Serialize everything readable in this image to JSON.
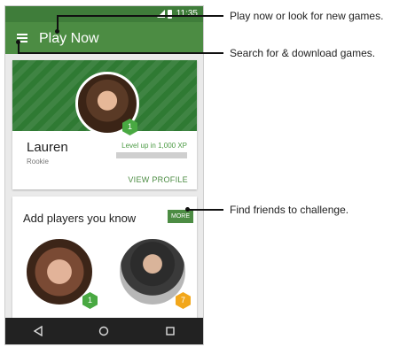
{
  "status_bar": {
    "time": "11:35"
  },
  "app_bar": {
    "title": "Play Now"
  },
  "profile": {
    "name": "Lauren",
    "rank": "Rookie",
    "level": "1",
    "level_up_text": "Level up in 1,000 XP",
    "xp_progress": 0,
    "view_profile_label": "VIEW PROFILE"
  },
  "players": {
    "title": "Add players you know",
    "more_label": "MORE",
    "items": [
      {
        "level": "1"
      },
      {
        "level": "7"
      }
    ]
  },
  "nav": {
    "back": "back-icon",
    "home": "home-icon",
    "recents": "recents-icon"
  },
  "callouts": {
    "menu": "Play now or look for new games.",
    "search": "Search for & download games.",
    "more": "Find friends to challenge."
  },
  "colors": {
    "app_bar": "#4c8c43",
    "status_bar": "#3f7d3a",
    "accent": "#49a942",
    "badge_orange": "#f2a71b"
  }
}
